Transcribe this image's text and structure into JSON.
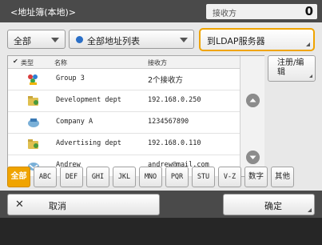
{
  "header": {
    "title": "<地址簿(本地)>",
    "recipient_label": "接收方",
    "recipient_count": "0"
  },
  "filters_top": {
    "type_select": "全部",
    "list_select": "全部地址列表",
    "ldap_button": "到LDAP服务器"
  },
  "list": {
    "columns": [
      "✔",
      "类型",
      "名称",
      "接收方"
    ],
    "rows": [
      {
        "icon": "group-icon",
        "name": "Group 3",
        "destination": "2个接收方"
      },
      {
        "icon": "folder-icon",
        "name": "Development dept",
        "destination": "192.168.0.250"
      },
      {
        "icon": "folder-icon",
        "name": "Company A",
        "destination": "1234567890"
      },
      {
        "icon": "folder-icon",
        "name": "Advertising dept",
        "destination": "192.168.0.110"
      },
      {
        "icon": "folder-icon",
        "name": "Andrew",
        "destination": "andrew@mail.com"
      }
    ]
  },
  "side_button": "注册/编辑",
  "index_tabs": [
    "全部",
    "ABC",
    "DEF",
    "GHI",
    "JKL",
    "MNO",
    "PQR",
    "STU",
    "V-Z",
    "数字",
    "其他"
  ],
  "footer": {
    "cancel_label": "取消",
    "ok_label": "确定"
  },
  "colors": {
    "accent": "#f0a400",
    "header_bg": "#4a4a4a",
    "scroll_btn": "#8c8c8c"
  }
}
